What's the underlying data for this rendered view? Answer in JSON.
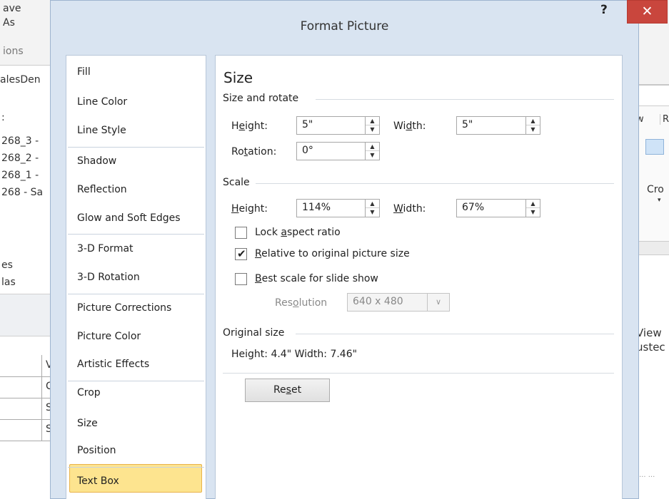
{
  "background": {
    "texts": [
      "ave",
      "As",
      "ions",
      "alesDen",
      ":",
      "268_3 -",
      "268_2 -",
      "268_1 -",
      "268 - Sa",
      "es",
      "las",
      "V",
      "C",
      "S",
      "S",
      "w",
      "R",
      "Cro",
      "View",
      "ustec"
    ]
  },
  "dialog": {
    "title": "Format Picture",
    "help": "?",
    "close": "✕",
    "nav": [
      "Fill",
      "Line Color",
      "Line Style",
      "Shadow",
      "Reflection",
      "Glow and Soft Edges",
      "3-D Format",
      "3-D Rotation",
      "Picture Corrections",
      "Picture Color",
      "Artistic Effects",
      "Crop",
      "Size",
      "Position",
      "Text Box"
    ],
    "selected_nav": "Size",
    "accent_color": "#fde48f",
    "size": {
      "heading": "Size",
      "size_rotate": {
        "label": "Size and rotate",
        "height": {
          "pre": "H",
          "u": "e",
          "post": "ight:",
          "value": "5\""
        },
        "width": {
          "pre": "Wi",
          "u": "d",
          "post": "th:",
          "value": "5\""
        },
        "rotation": {
          "pre": "Ro",
          "u": "t",
          "post": "ation:",
          "value": "0°"
        }
      },
      "scale": {
        "label": "Scale",
        "height": {
          "pre": "",
          "u": "H",
          "post": "eight:",
          "value": "114%"
        },
        "width": {
          "pre": "",
          "u": "W",
          "post": "idth:",
          "value": "67%"
        },
        "lock": {
          "pre": "Lock ",
          "u": "a",
          "post": "spect ratio",
          "checked": false
        },
        "relative": {
          "pre": "",
          "u": "R",
          "post": "elative to original picture size",
          "checked": true
        },
        "best": {
          "pre": "",
          "u": "B",
          "post": "est scale for slide show",
          "checked": false
        },
        "resolution": {
          "pre": "Res",
          "u": "o",
          "post": "lution",
          "value": "640 x 480"
        }
      },
      "original": {
        "label": "Original size",
        "text": "Height:  4.4\"   Width:   7.46\""
      },
      "reset": {
        "pre": "Re",
        "u": "s",
        "post": "et"
      }
    }
  }
}
